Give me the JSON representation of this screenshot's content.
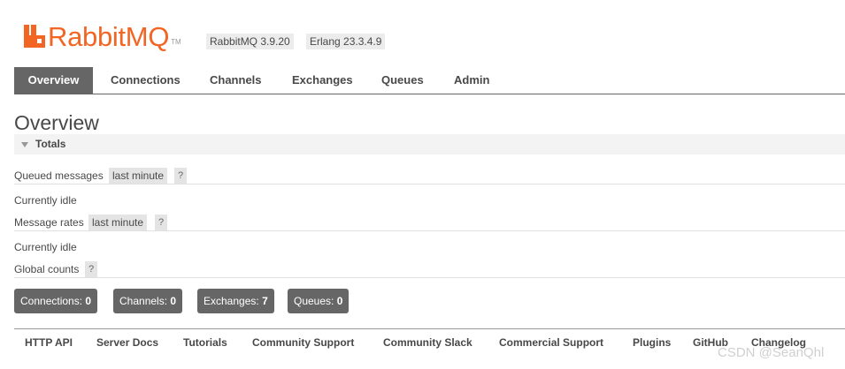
{
  "header": {
    "logo_text": "RabbitMQ",
    "logo_tm": "TM",
    "version": "RabbitMQ 3.9.20",
    "erlang": "Erlang 23.3.4.9",
    "accent": "#f26522"
  },
  "tabs": [
    {
      "label": "Overview",
      "active": true
    },
    {
      "label": "Connections"
    },
    {
      "label": "Channels"
    },
    {
      "label": "Exchanges"
    },
    {
      "label": "Queues"
    },
    {
      "label": "Admin"
    }
  ],
  "overview": {
    "title": "Overview",
    "section": "Totals",
    "queued_messages": {
      "label": "Queued messages",
      "range": "last minute",
      "help": "?"
    },
    "queued_status": "Currently idle",
    "message_rates": {
      "label": "Message rates",
      "range": "last minute",
      "help": "?"
    },
    "rates_status": "Currently idle",
    "global_counts": {
      "label": "Global counts",
      "help": "?"
    },
    "counts": [
      {
        "label": "Connections:",
        "value": "0"
      },
      {
        "label": "Channels:",
        "value": "0"
      },
      {
        "label": "Exchanges:",
        "value": "7"
      },
      {
        "label": "Queues:",
        "value": "0"
      }
    ]
  },
  "footer": {
    "links": [
      "HTTP API",
      "Server Docs",
      "Tutorials",
      "Community Support",
      "Community Slack",
      "Commercial Support",
      "Plugins",
      "GitHub",
      "Changelog"
    ]
  },
  "watermark": "CSDN @SeanQhl"
}
